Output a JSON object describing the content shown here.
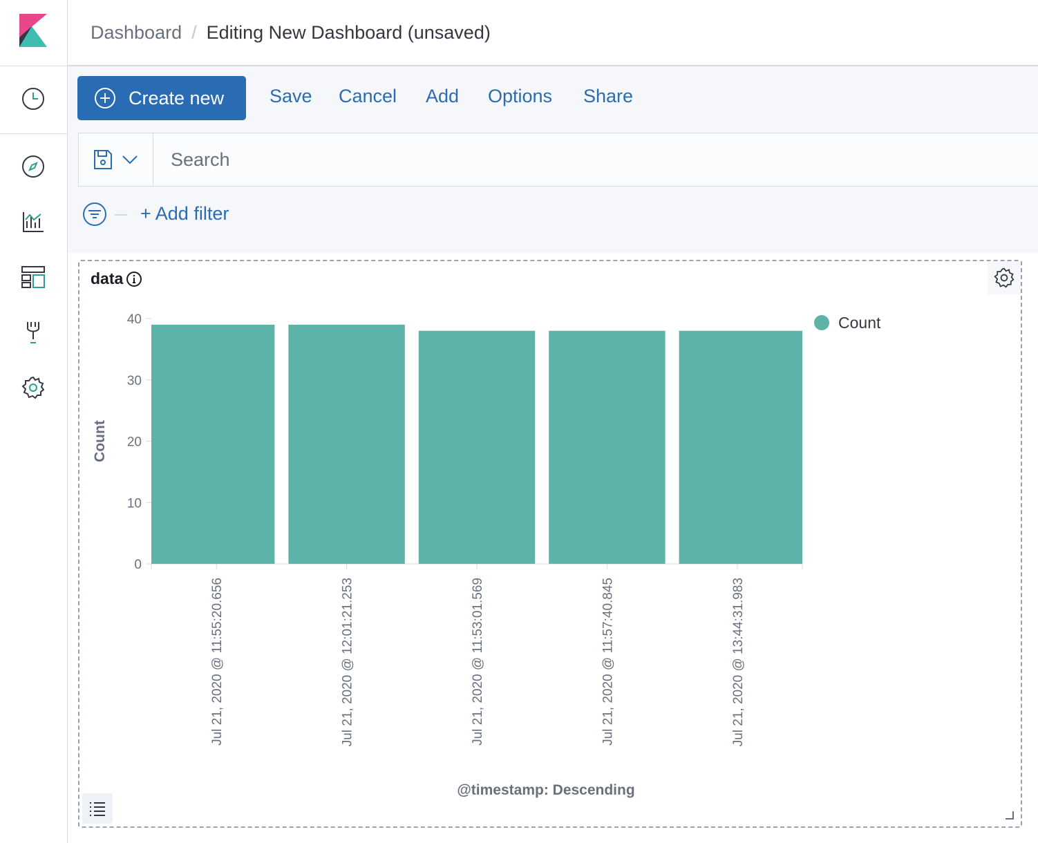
{
  "breadcrumbs": [
    "Dashboard",
    "Editing New Dashboard (unsaved)"
  ],
  "nav": {
    "items": [
      "recently-viewed",
      "discover",
      "visualize",
      "dashboard",
      "dev-tools",
      "management"
    ]
  },
  "toolbar": {
    "create_label": "Create new",
    "links": [
      "Save",
      "Cancel",
      "Add",
      "Options",
      "Share"
    ]
  },
  "search": {
    "placeholder": "Search",
    "value": ""
  },
  "filter": {
    "add_label": "+ Add filter"
  },
  "panel": {
    "title": "data"
  },
  "colors": {
    "accent": "#2a6cb3",
    "bar": "#5db3a8",
    "logo_pink": "#e8478b",
    "logo_teal": "#3ebeb0",
    "logo_dark": "#343741"
  },
  "chart_data": {
    "type": "bar",
    "categories": [
      "Jul 21, 2020 @ 11:55:20.656",
      "Jul 21, 2020 @ 12:01:21.253",
      "Jul 21, 2020 @ 11:53:01.569",
      "Jul 21, 2020 @ 11:57:40.845",
      "Jul 21, 2020 @ 13:44:31.983"
    ],
    "series": [
      {
        "name": "Count",
        "values": [
          39,
          39,
          38,
          38,
          38
        ]
      }
    ],
    "ylabel": "Count",
    "xlabel": "@timestamp: Descending",
    "yticks": [
      0,
      10,
      20,
      30,
      40
    ],
    "ylim": [
      0,
      40
    ],
    "legend": "top-right"
  }
}
